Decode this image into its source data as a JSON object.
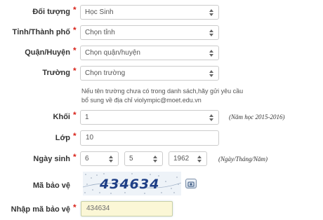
{
  "form": {
    "doi_tuong": {
      "label": "Đối tượng",
      "value": "Học Sinh"
    },
    "tinh": {
      "label": "Tỉnh/Thành phố",
      "value": "Chọn tỉnh"
    },
    "quan": {
      "label": "Quận/Huyện",
      "value": "Chọn quận/huyện"
    },
    "truong": {
      "label": "Trường",
      "value": "Chọn trường"
    },
    "note_line1": "Nếu tên trường chưa có trong danh sách,hãy gửi yêu cầu",
    "note_line2_prefix": "bổ sung về địa chỉ ",
    "note_email": "violympic@moet.edu.vn",
    "khoi": {
      "label": "Khối",
      "value": "1",
      "hint": "(Năm học 2015-2016)"
    },
    "lop": {
      "label": "Lớp",
      "value": "10"
    },
    "ngay_sinh": {
      "label": "Ngày sinh",
      "day": "6",
      "month": "5",
      "year": "1962",
      "hint": "(Ngày/Tháng/Năm)"
    },
    "ma_bao_ve": {
      "label": "Mã bảo vệ",
      "captcha_text": "434634"
    },
    "nhap_ma": {
      "label": "Nhập mã bảo vệ",
      "value": "434634"
    },
    "required_mark": "*"
  },
  "colors": {
    "required": "#d9241b",
    "captcha_text": "#1f3f86",
    "input_highlight": "#fbf7d6"
  },
  "icons": {
    "dropdown": "updown-caret-icon",
    "refresh": "refresh-captcha-icon"
  }
}
